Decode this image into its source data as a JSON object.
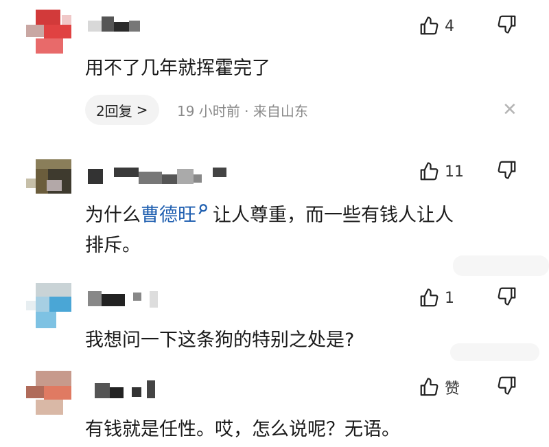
{
  "comments": [
    {
      "text": "用不了几年就挥霍完了",
      "like_count": "4",
      "reply_label": "2回复",
      "reply_chevron": ">",
      "meta": "19 小时前 · 来自山东",
      "close": "✕"
    },
    {
      "text_before": "为什么",
      "link_text": "曹德旺",
      "text_after_line1": "让人尊重，而一些有钱人让人",
      "text_line2": "排斥。",
      "like_count": "11"
    },
    {
      "text": "我想问一下这条狗的特别之处是?",
      "like_count": "1"
    },
    {
      "text": "有钱就是任性。哎，怎么说呢？无语。",
      "like_count": "赞"
    }
  ],
  "icons": {
    "like": "thumbs-up-icon",
    "dislike": "thumbs-down-icon",
    "search": "search-icon",
    "close": "close-icon",
    "chevron": "chevron-right-icon"
  },
  "colors": {
    "link": "#1f5fb0",
    "meta": "#8a8a8a",
    "reply_bg": "#f3f3f3"
  }
}
